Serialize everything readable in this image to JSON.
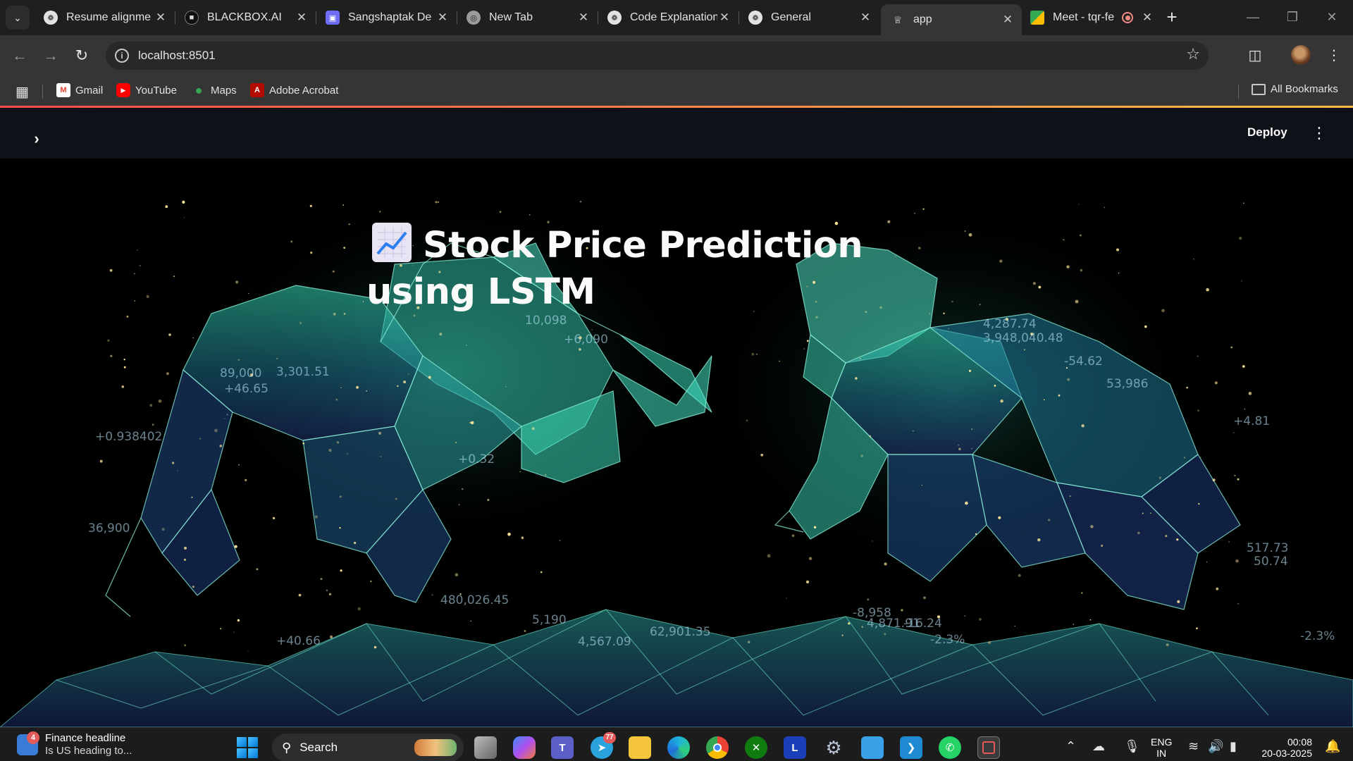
{
  "browser": {
    "tabs": [
      {
        "label": "Resume alignme",
        "icon": "openai-icon"
      },
      {
        "label": "BLACKBOX.AI",
        "icon": "blackbox-icon"
      },
      {
        "label": "Sangshaptak De",
        "icon": "app-icon"
      },
      {
        "label": "New Tab",
        "icon": "globe-icon"
      },
      {
        "label": "Code Explanation",
        "icon": "openai-icon"
      },
      {
        "label": "General",
        "icon": "openai-icon"
      },
      {
        "label": "app",
        "icon": "streamlit-icon",
        "active": true
      },
      {
        "label": "Meet - tqr-fe",
        "icon": "meet-icon",
        "recording": true
      }
    ],
    "url": "localhost:8501",
    "bookmarks": [
      {
        "label": "Gmail",
        "icon": "gmail-icon"
      },
      {
        "label": "YouTube",
        "icon": "youtube-icon"
      },
      {
        "label": "Maps",
        "icon": "maps-icon"
      },
      {
        "label": "Adobe Acrobat",
        "icon": "acrobat-icon"
      }
    ],
    "all_bookmarks": "All Bookmarks"
  },
  "app": {
    "deploy_label": "Deploy",
    "title_emoji": "chart-increasing-emoji",
    "title": "Stock Price Prediction using LSTM",
    "background_numbers": [
      "+0.938402",
      "89,000",
      "+46.65",
      "3,301.51",
      "10,098",
      "+6,090",
      "+0.32",
      "36,900",
      "+40.66",
      "480,026.45",
      "5,190",
      "4,567.09",
      "62,901.35",
      "4,287.74",
      "3,948,040.48",
      "-54.62",
      "53,986",
      "+4.81",
      "-2.3%",
      "-8,958",
      "4,871.91",
      "-16.24",
      "-2.3%",
      "517.73",
      "50.74"
    ],
    "accent_colors": {
      "teal": "#3de0c0",
      "blue": "#2a4fa8",
      "streamlit_red": "#ff4b4b",
      "streamlit_orange": "#ffbd45"
    }
  },
  "taskbar": {
    "widget_badge": "4",
    "widget_title": "Finance headline",
    "widget_sub": "Is US heading to...",
    "search_placeholder": "Search",
    "apps": [
      {
        "name": "task-view",
        "icon": "task-view-icon"
      },
      {
        "name": "copilot",
        "icon": "copilot-icon"
      },
      {
        "name": "teams",
        "icon": "teams-icon"
      },
      {
        "name": "telegram",
        "icon": "telegram-icon",
        "badge": "77"
      },
      {
        "name": "file-explorer",
        "icon": "folder-icon"
      },
      {
        "name": "edge",
        "icon": "edge-icon"
      },
      {
        "name": "chrome",
        "icon": "chrome-icon"
      },
      {
        "name": "xbox",
        "icon": "xbox-icon"
      },
      {
        "name": "l-app",
        "icon": "l-icon",
        "letter": "L"
      },
      {
        "name": "settings",
        "icon": "gear-icon"
      },
      {
        "name": "remote-desktop",
        "icon": "monitor-icon"
      },
      {
        "name": "vscode",
        "icon": "vscode-icon"
      },
      {
        "name": "whatsapp",
        "icon": "whatsapp-icon"
      },
      {
        "name": "snipping-tool",
        "icon": "snipping-icon"
      }
    ],
    "lang_top": "ENG",
    "lang_bottom": "IN",
    "time": "00:08",
    "date": "20-03-2025"
  }
}
